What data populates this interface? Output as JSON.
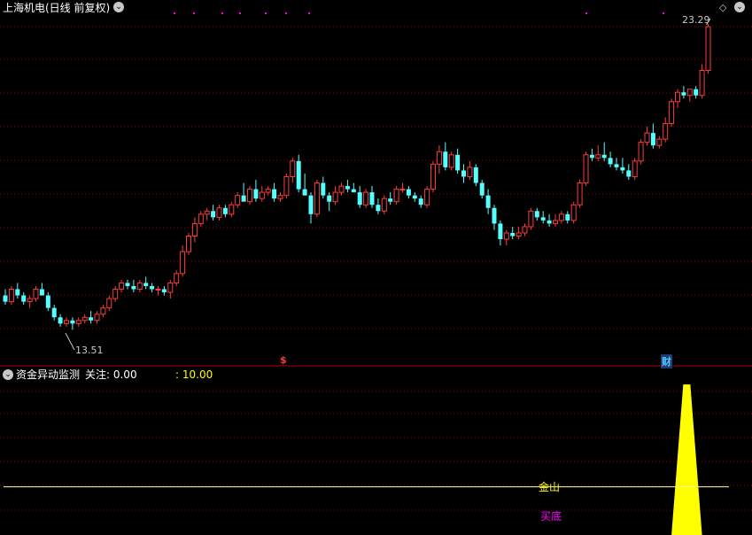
{
  "header": {
    "title": "上海机电(日线 前复权)",
    "menu_glyph": "⌄",
    "diamond_glyph": "◇"
  },
  "price_panel": {
    "high_label": "23.29",
    "low_label": "13.51",
    "marker_s": "$",
    "marker_cai": "财"
  },
  "indicator_panel": {
    "name": "资金异动监测",
    "focus_label": "关注: 0.00",
    "value_label": ": 10.00",
    "signal_jinchu": "金山",
    "signal_maidi": "买底"
  },
  "colors": {
    "up": "#ff3b3b",
    "down": "#54ffff",
    "grid": "#8b0000",
    "yellow": "#ffff00",
    "magenta": "#ff00ff",
    "line": "#ffffa0"
  },
  "chart_data": {
    "type": "candlestick",
    "ylim": [
      13.0,
      23.6
    ],
    "high": 23.29,
    "low": 13.51,
    "candles": [
      [
        14.6,
        14.8,
        14.3,
        14.4
      ],
      [
        14.4,
        14.9,
        14.3,
        14.8
      ],
      [
        14.8,
        15.0,
        14.5,
        14.6
      ],
      [
        14.6,
        14.7,
        14.3,
        14.4
      ],
      [
        14.4,
        14.6,
        14.2,
        14.5
      ],
      [
        14.5,
        14.9,
        14.4,
        14.8
      ],
      [
        14.8,
        15.0,
        14.6,
        14.6
      ],
      [
        14.6,
        14.7,
        14.1,
        14.2
      ],
      [
        14.2,
        14.3,
        13.8,
        13.9
      ],
      [
        13.9,
        14.0,
        13.6,
        13.7
      ],
      [
        13.7,
        13.9,
        13.6,
        13.8
      ],
      [
        13.8,
        13.9,
        13.5,
        13.7
      ],
      [
        13.7,
        13.9,
        13.6,
        13.8
      ],
      [
        13.8,
        14.0,
        13.7,
        13.9
      ],
      [
        13.9,
        14.1,
        13.7,
        13.8
      ],
      [
        13.8,
        14.1,
        13.7,
        14.0
      ],
      [
        14.0,
        14.3,
        13.9,
        14.2
      ],
      [
        14.2,
        14.6,
        14.1,
        14.5
      ],
      [
        14.5,
        14.9,
        14.4,
        14.8
      ],
      [
        14.8,
        15.1,
        14.7,
        15.0
      ],
      [
        15.0,
        15.1,
        14.8,
        14.9
      ],
      [
        14.9,
        15.1,
        14.7,
        14.8
      ],
      [
        14.8,
        15.1,
        14.7,
        15.0
      ],
      [
        15.0,
        15.2,
        14.8,
        14.9
      ],
      [
        14.9,
        15.0,
        14.7,
        14.8
      ],
      [
        14.8,
        14.9,
        14.6,
        14.8
      ],
      [
        14.8,
        14.9,
        14.6,
        14.7
      ],
      [
        14.7,
        15.1,
        14.5,
        15.0
      ],
      [
        15.0,
        15.4,
        14.9,
        15.3
      ],
      [
        15.3,
        16.2,
        15.2,
        16.0
      ],
      [
        16.0,
        16.6,
        15.9,
        16.5
      ],
      [
        16.5,
        17.1,
        16.3,
        16.9
      ],
      [
        16.9,
        17.3,
        16.8,
        17.2
      ],
      [
        17.2,
        17.4,
        17.0,
        17.3
      ],
      [
        17.3,
        17.5,
        17.0,
        17.1
      ],
      [
        17.1,
        17.5,
        17.0,
        17.4
      ],
      [
        17.4,
        17.5,
        17.1,
        17.2
      ],
      [
        17.2,
        17.6,
        17.1,
        17.5
      ],
      [
        17.5,
        17.9,
        17.4,
        17.8
      ],
      [
        17.8,
        18.2,
        17.7,
        17.6
      ],
      [
        17.6,
        18.1,
        17.5,
        18.0
      ],
      [
        18.0,
        18.3,
        17.6,
        17.7
      ],
      [
        17.7,
        18.1,
        17.6,
        17.9
      ],
      [
        17.9,
        18.1,
        17.8,
        18.0
      ],
      [
        18.0,
        18.2,
        17.6,
        17.7
      ],
      [
        17.7,
        17.9,
        17.6,
        17.8
      ],
      [
        17.8,
        18.5,
        17.7,
        18.4
      ],
      [
        18.4,
        19.0,
        18.2,
        18.9
      ],
      [
        18.9,
        19.1,
        17.9,
        18.0
      ],
      [
        18.0,
        18.5,
        17.8,
        17.8
      ],
      [
        17.8,
        17.9,
        16.9,
        17.2
      ],
      [
        17.2,
        18.3,
        17.1,
        18.2
      ],
      [
        18.2,
        18.4,
        17.7,
        17.8
      ],
      [
        17.8,
        17.9,
        17.3,
        17.6
      ],
      [
        17.6,
        18.1,
        17.5,
        17.9
      ],
      [
        17.9,
        18.2,
        17.8,
        18.1
      ],
      [
        18.1,
        18.3,
        17.9,
        18.0
      ],
      [
        18.0,
        18.2,
        17.9,
        17.9
      ],
      [
        17.9,
        18.1,
        17.4,
        17.5
      ],
      [
        17.5,
        18.0,
        17.4,
        17.9
      ],
      [
        17.9,
        18.1,
        17.4,
        17.5
      ],
      [
        17.5,
        17.7,
        17.2,
        17.3
      ],
      [
        17.3,
        17.8,
        17.2,
        17.7
      ],
      [
        17.7,
        17.9,
        17.5,
        17.6
      ],
      [
        17.6,
        18.1,
        17.5,
        18.0
      ],
      [
        18.0,
        18.2,
        17.9,
        18.0
      ],
      [
        18.0,
        18.1,
        17.7,
        17.8
      ],
      [
        17.8,
        17.9,
        17.6,
        17.7
      ],
      [
        17.7,
        17.8,
        17.4,
        17.5
      ],
      [
        17.5,
        18.1,
        17.4,
        18.0
      ],
      [
        18.0,
        18.9,
        17.9,
        18.8
      ],
      [
        18.8,
        19.4,
        18.5,
        19.2
      ],
      [
        19.2,
        19.5,
        18.6,
        18.7
      ],
      [
        18.7,
        19.2,
        18.6,
        19.1
      ],
      [
        19.1,
        19.3,
        18.5,
        18.6
      ],
      [
        18.6,
        18.8,
        18.2,
        18.4
      ],
      [
        18.4,
        18.9,
        18.3,
        18.7
      ],
      [
        18.7,
        18.8,
        18.1,
        18.2
      ],
      [
        18.2,
        18.3,
        17.7,
        17.8
      ],
      [
        17.8,
        18.0,
        17.2,
        17.4
      ],
      [
        17.4,
        17.5,
        16.7,
        16.9
      ],
      [
        16.9,
        17.0,
        16.2,
        16.4
      ],
      [
        16.4,
        16.7,
        16.2,
        16.6
      ],
      [
        16.6,
        16.8,
        16.4,
        16.5
      ],
      [
        16.5,
        16.8,
        16.4,
        16.6
      ],
      [
        16.6,
        16.9,
        16.5,
        16.8
      ],
      [
        16.8,
        17.4,
        16.7,
        17.3
      ],
      [
        17.3,
        17.4,
        17.0,
        17.1
      ],
      [
        17.1,
        17.3,
        16.9,
        17.0
      ],
      [
        17.0,
        17.2,
        16.8,
        16.9
      ],
      [
        16.9,
        17.2,
        16.8,
        17.0
      ],
      [
        17.0,
        17.3,
        16.9,
        17.2
      ],
      [
        17.2,
        17.3,
        16.9,
        17.0
      ],
      [
        17.0,
        17.6,
        16.9,
        17.5
      ],
      [
        17.5,
        18.3,
        17.4,
        18.2
      ],
      [
        18.2,
        19.2,
        18.1,
        19.1
      ],
      [
        19.1,
        19.3,
        18.9,
        19.0
      ],
      [
        19.0,
        19.4,
        18.9,
        19.1
      ],
      [
        19.1,
        19.5,
        18.9,
        19.0
      ],
      [
        19.0,
        19.2,
        18.7,
        18.8
      ],
      [
        18.8,
        19.0,
        18.6,
        18.7
      ],
      [
        18.7,
        19.0,
        18.5,
        18.6
      ],
      [
        18.6,
        18.8,
        18.3,
        18.4
      ],
      [
        18.4,
        19.0,
        18.3,
        18.9
      ],
      [
        18.9,
        19.6,
        18.8,
        19.5
      ],
      [
        19.5,
        20.0,
        19.4,
        19.8
      ],
      [
        19.8,
        20.1,
        19.3,
        19.4
      ],
      [
        19.4,
        19.7,
        19.3,
        19.6
      ],
      [
        19.6,
        20.3,
        19.5,
        20.1
      ],
      [
        20.1,
        20.9,
        20.0,
        20.8
      ],
      [
        20.8,
        21.2,
        20.6,
        21.1
      ],
      [
        21.1,
        21.3,
        20.9,
        21.0
      ],
      [
        21.0,
        21.2,
        20.8,
        21.2
      ],
      [
        21.2,
        21.3,
        20.9,
        21.0
      ],
      [
        21.0,
        22.0,
        20.9,
        21.8
      ],
      [
        21.8,
        23.29,
        21.7,
        23.2
      ]
    ],
    "indicator": {
      "ylim": [
        0,
        10
      ],
      "spike": {
        "start": 109,
        "peak": 111.5,
        "end": 114,
        "value": 10.0
      },
      "threshold": 3.2
    }
  }
}
